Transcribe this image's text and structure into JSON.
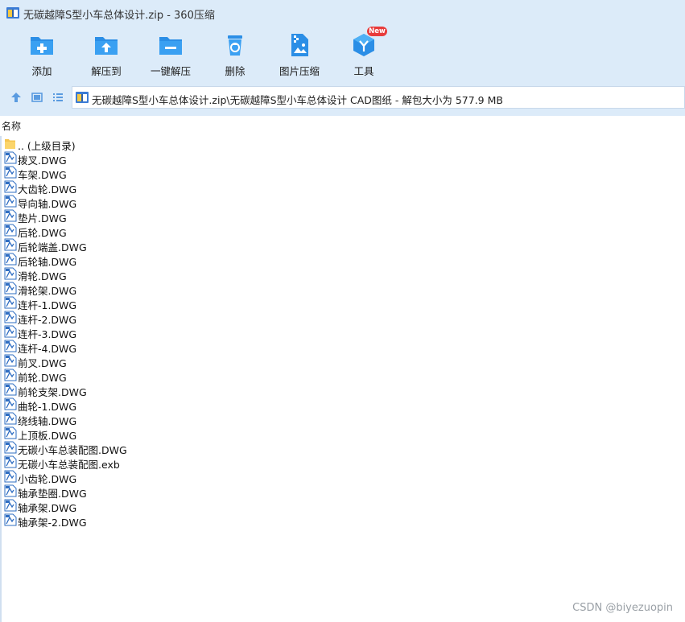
{
  "window": {
    "title": "无碳越障S型小车总体设计.zip - 360压缩"
  },
  "toolbar": {
    "items": [
      {
        "label": "添加",
        "icon": "add-folder-icon"
      },
      {
        "label": "解压到",
        "icon": "extract-to-folder-icon"
      },
      {
        "label": "一键解压",
        "icon": "one-click-extract-icon"
      },
      {
        "label": "删除",
        "icon": "recycle-bin-icon"
      },
      {
        "label": "图片压缩",
        "icon": "image-compress-icon"
      },
      {
        "label": "工具",
        "icon": "tools-cube-icon"
      }
    ],
    "new_badge": "New"
  },
  "address": {
    "path": "无碳越障S型小车总体设计.zip\\无碳越障S型小车总体设计 CAD图纸 - 解包大小为 577.9 MB"
  },
  "list": {
    "header_name": "名称",
    "parent": ".. (上级目录)",
    "files": [
      "拨叉.DWG",
      "车架.DWG",
      "大齿轮.DWG",
      "导向轴.DWG",
      "垫片.DWG",
      "后轮.DWG",
      "后轮端盖.DWG",
      "后轮轴.DWG",
      "滑轮.DWG",
      "滑轮架.DWG",
      "连杆-1.DWG",
      "连杆-2.DWG",
      "连杆-3.DWG",
      "连杆-4.DWG",
      "前叉.DWG",
      "前轮.DWG",
      "前轮支架.DWG",
      "曲轮-1.DWG",
      "绕线轴.DWG",
      "上顶板.DWG",
      "无碳小车总装配图.DWG",
      "无碳小车总装配图.exb",
      "小齿轮.DWG",
      "轴承垫圈.DWG",
      "轴承架.DWG",
      "轴承架-2.DWG"
    ]
  },
  "watermark": "CSDN @biyezuopin",
  "colors": {
    "chrome": "#dcebf9",
    "accent": "#1e88e5",
    "badge": "#e83b3b"
  }
}
